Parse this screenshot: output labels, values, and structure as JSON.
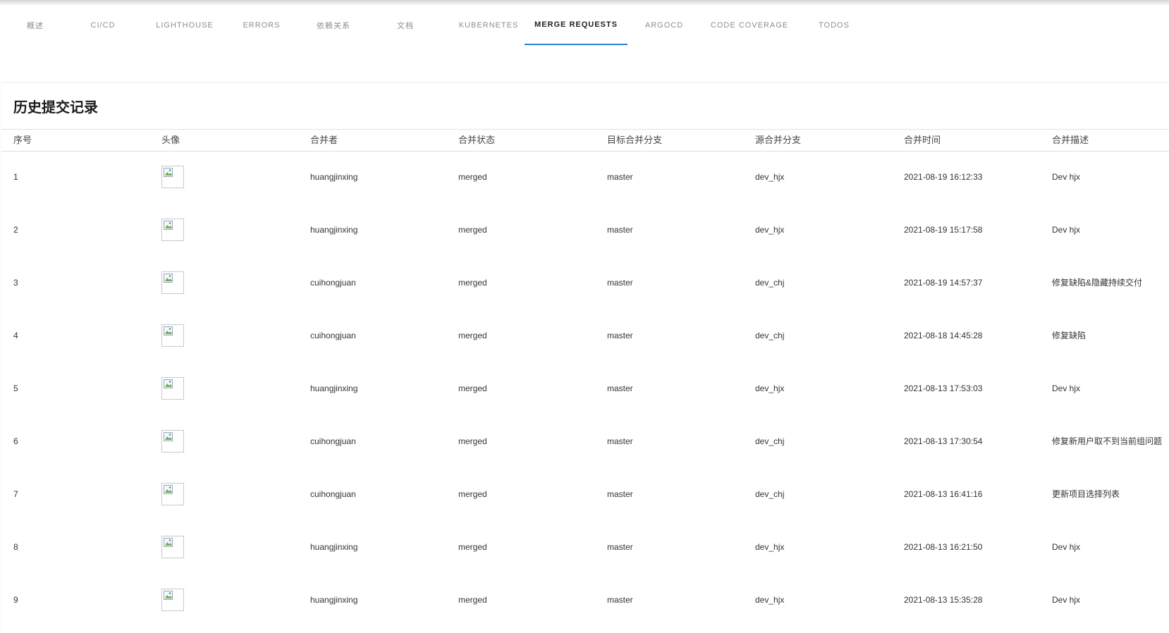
{
  "tabs": [
    {
      "label": "概述",
      "active": false
    },
    {
      "label": "CI/CD",
      "active": false
    },
    {
      "label": "LIGHTHOUSE",
      "active": false
    },
    {
      "label": "ERRORS",
      "active": false
    },
    {
      "label": "依赖关系",
      "active": false
    },
    {
      "label": "文档",
      "active": false
    },
    {
      "label": "KUBERNETES",
      "active": false
    },
    {
      "label": "MERGE REQUESTS",
      "active": true
    },
    {
      "label": "ARGOCD",
      "active": false
    },
    {
      "label": "CODE COVERAGE",
      "active": false
    },
    {
      "label": "TODOS",
      "active": false
    }
  ],
  "accent_color": "#2f80d8",
  "card": {
    "title": "历史提交记录"
  },
  "table": {
    "columns": [
      "序号",
      "头像",
      "合并者",
      "合并状态",
      "目标合并分支",
      "源合并分支",
      "合并时间",
      "合并描述"
    ],
    "rows": [
      {
        "index": "1",
        "avatar_icon": "broken-image-icon",
        "merger": "huangjinxing",
        "status": "merged",
        "target": "master",
        "source": "dev_hjx",
        "time": "2021-08-19 16:12:33",
        "desc": "Dev hjx"
      },
      {
        "index": "2",
        "avatar_icon": "broken-image-icon",
        "merger": "huangjinxing",
        "status": "merged",
        "target": "master",
        "source": "dev_hjx",
        "time": "2021-08-19 15:17:58",
        "desc": "Dev hjx"
      },
      {
        "index": "3",
        "avatar_icon": "broken-image-icon",
        "merger": "cuihongjuan",
        "status": "merged",
        "target": "master",
        "source": "dev_chj",
        "time": "2021-08-19 14:57:37",
        "desc": "修复缺陷&隐藏持续交付"
      },
      {
        "index": "4",
        "avatar_icon": "broken-image-icon",
        "merger": "cuihongjuan",
        "status": "merged",
        "target": "master",
        "source": "dev_chj",
        "time": "2021-08-18 14:45:28",
        "desc": "修复缺陷"
      },
      {
        "index": "5",
        "avatar_icon": "broken-image-icon",
        "merger": "huangjinxing",
        "status": "merged",
        "target": "master",
        "source": "dev_hjx",
        "time": "2021-08-13 17:53:03",
        "desc": "Dev hjx"
      },
      {
        "index": "6",
        "avatar_icon": "broken-image-icon",
        "merger": "cuihongjuan",
        "status": "merged",
        "target": "master",
        "source": "dev_chj",
        "time": "2021-08-13 17:30:54",
        "desc": "修复新用户取不到当前组问题"
      },
      {
        "index": "7",
        "avatar_icon": "broken-image-icon",
        "merger": "cuihongjuan",
        "status": "merged",
        "target": "master",
        "source": "dev_chj",
        "time": "2021-08-13 16:41:16",
        "desc": "更新项目选择列表"
      },
      {
        "index": "8",
        "avatar_icon": "broken-image-icon",
        "merger": "huangjinxing",
        "status": "merged",
        "target": "master",
        "source": "dev_hjx",
        "time": "2021-08-13 16:21:50",
        "desc": "Dev hjx"
      },
      {
        "index": "9",
        "avatar_icon": "broken-image-icon",
        "merger": "huangjinxing",
        "status": "merged",
        "target": "master",
        "source": "dev_hjx",
        "time": "2021-08-13 15:35:28",
        "desc": "Dev hjx"
      }
    ]
  }
}
